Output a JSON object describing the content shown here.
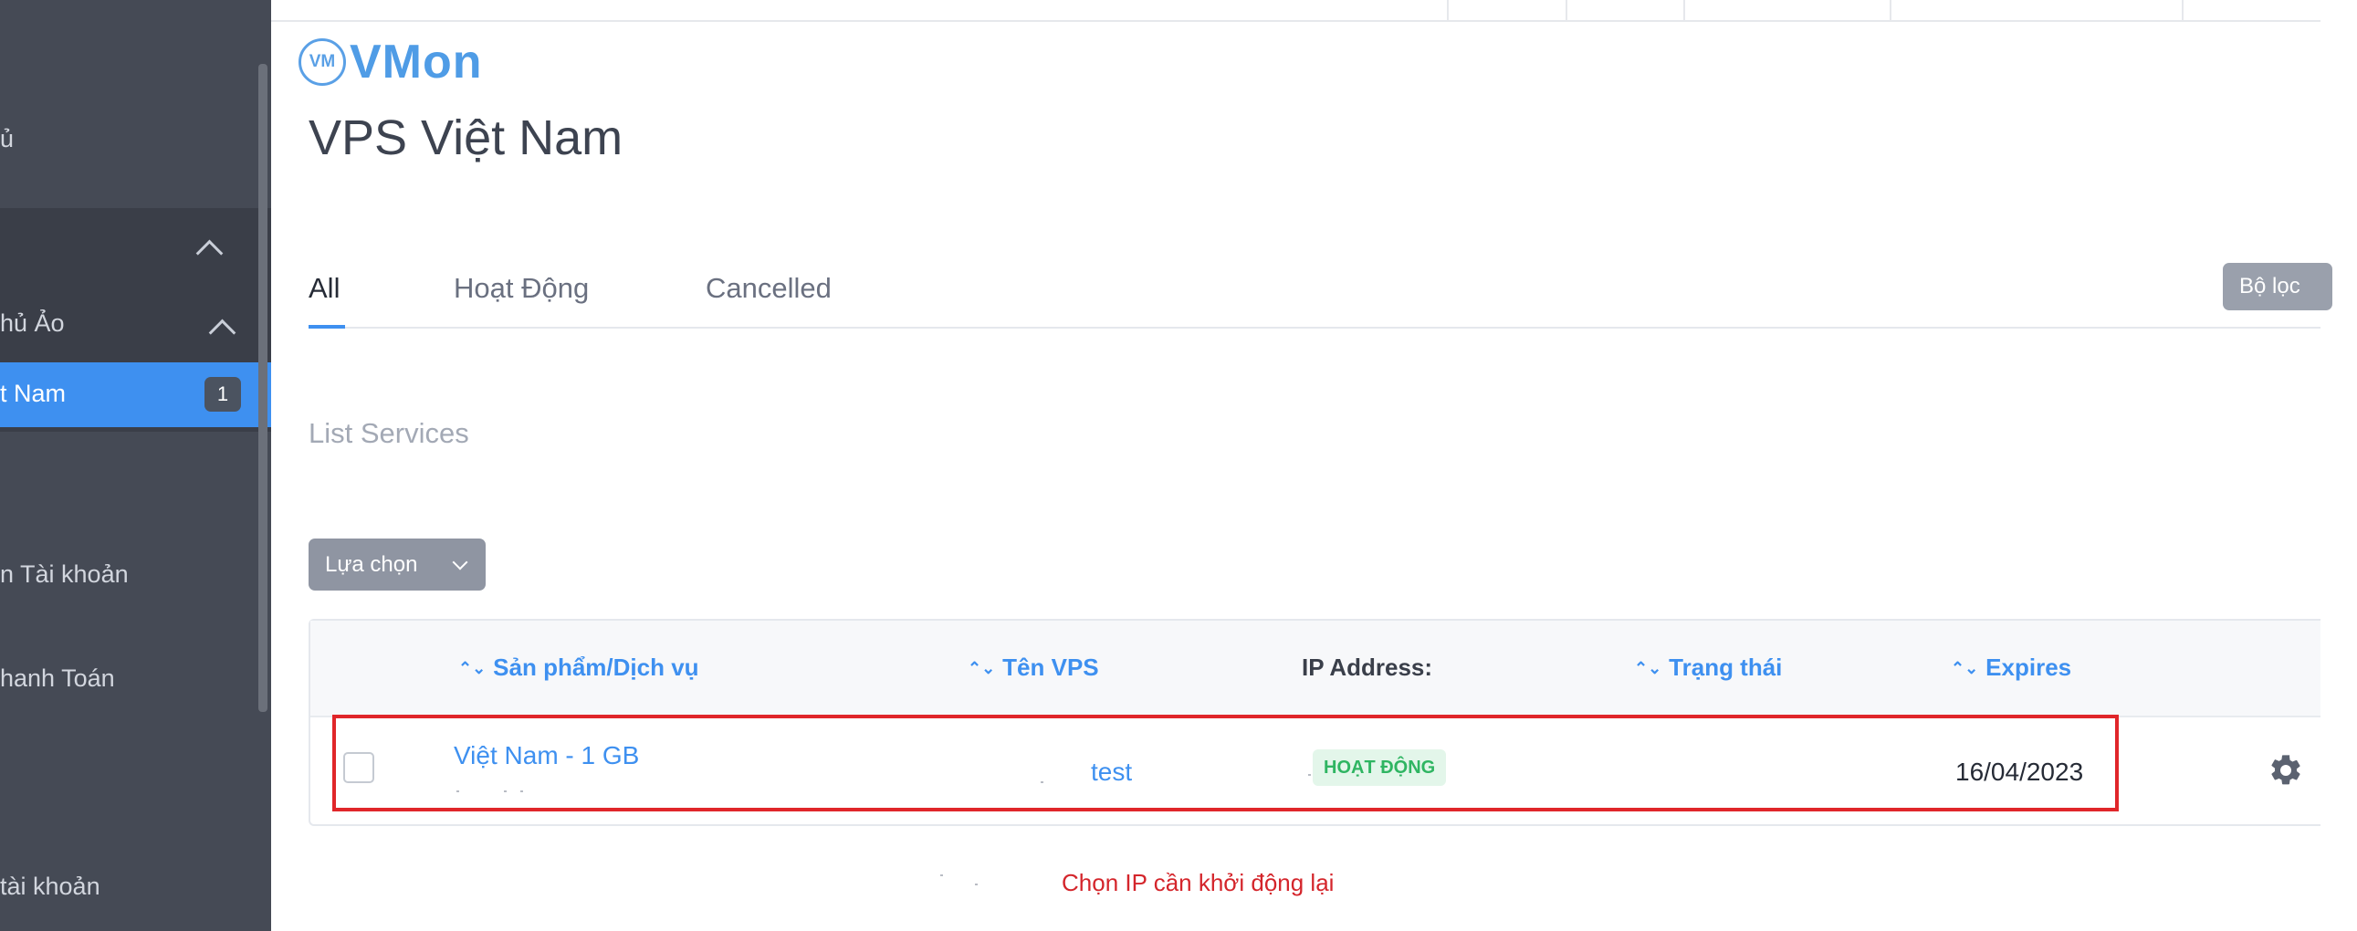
{
  "sidebar": {
    "items": [
      {
        "label": "ủ"
      },
      {
        "label": "hủ Ảo"
      },
      {
        "label": "t Nam",
        "badge": "1"
      },
      {
        "label": "n Tài khoản"
      },
      {
        "label": "hanh Toán"
      },
      {
        "label": "tài khoản"
      }
    ]
  },
  "logo": {
    "badge": "VM",
    "text": "VMon"
  },
  "page": {
    "title": "VPS Việt Nam"
  },
  "tabs": [
    {
      "label": "All"
    },
    {
      "label": "Hoạt Động"
    },
    {
      "label": "Cancelled"
    }
  ],
  "filter": {
    "label": "Bộ lọc"
  },
  "list": {
    "title": "List Services"
  },
  "select": {
    "label": "Lựa chọn"
  },
  "table": {
    "columns": [
      "Sản phẩm/Dịch vụ",
      "Tên VPS",
      "IP Address:",
      "Trạng thái",
      "Expires"
    ],
    "rows": [
      {
        "product": "Việt Nam - 1 GB",
        "name": "test",
        "ip": "",
        "status": "HOẠT ĐỘNG",
        "expires": "16/04/2023"
      }
    ]
  },
  "annotation": {
    "note": "Chọn IP cần khởi động lại"
  },
  "colors": {
    "accent": "#3e90f0",
    "highlight": "#e0262a",
    "status": "#2fb562"
  }
}
